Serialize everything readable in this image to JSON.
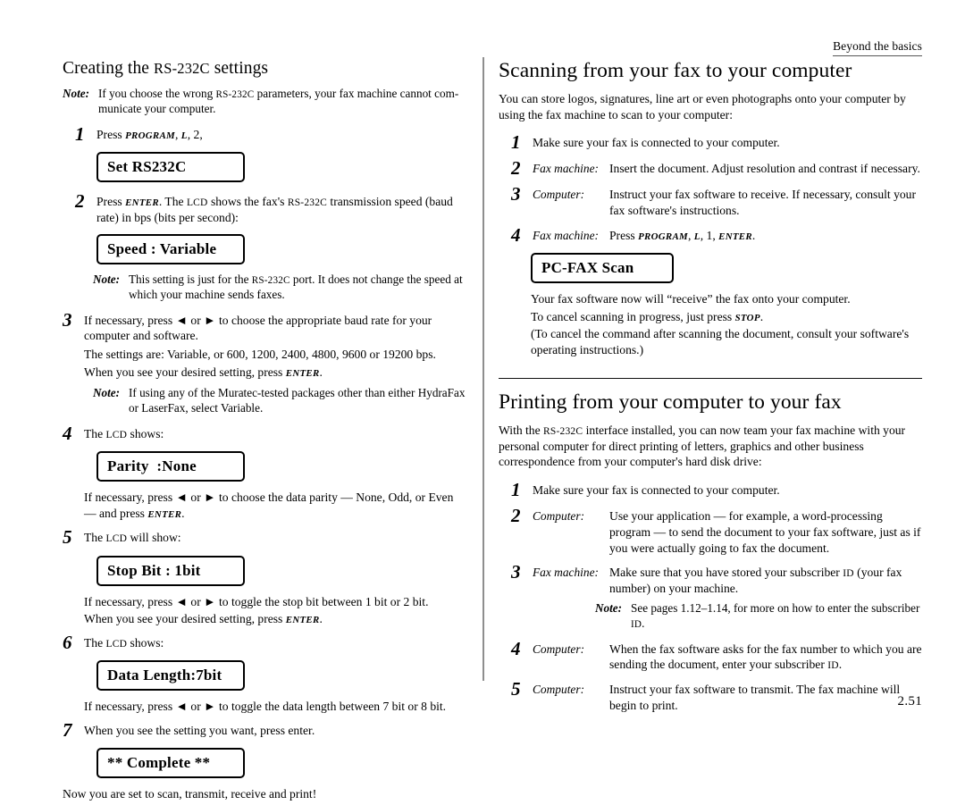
{
  "running_head": "Beyond the basics",
  "folio": "2.51",
  "left_column": {
    "heading_pre": "Creating the ",
    "heading_sc": "RS-232C",
    "heading_post": " settings",
    "note_top": {
      "label": "Note:",
      "text_a": "If you choose the wrong ",
      "text_sc": "RS-232C",
      "text_b": " parameters, your fax machine cannot com-municate your computer."
    },
    "step1": {
      "num": "1",
      "text_a": "Press ",
      "kbd1": "PROGRAM",
      "text_b": ", ",
      "kbd2": "L",
      "text_c": ", 2,"
    },
    "lcd1": "Set RS232C",
    "step2": {
      "num": "2",
      "text_a": "Press ",
      "kbd1": "ENTER",
      "text_b": ". The ",
      "sc1": "LCD",
      "text_c": " shows the fax's ",
      "sc2": "RS-232C",
      "text_d": " transmission speed (baud rate) in bps (bits per second):"
    },
    "lcd2": "Speed : Variable",
    "note2": {
      "label": "Note:",
      "text_a": "This setting is just for the ",
      "text_sc": "RS-232C",
      "text_b": " port. It does not change the speed at which your machine sends faxes."
    },
    "step3": {
      "num": "3",
      "text_a": "If necessary, press ",
      "arrow_left": "◄",
      "text_or": " or ",
      "arrow_right": "►",
      "text_b": " to choose the appropriate baud rate for your computer and software.",
      "line2": "The settings are: Variable, or 600, 1200, 2400, 4800, 9600 or 19200 bps.",
      "line3_a": "When you see your desired setting, press ",
      "line3_kbd": "ENTER",
      "line3_b": "."
    },
    "note3": {
      "label": "Note:",
      "text": "If using any of the Muratec-tested packages other than either HydraFax or LaserFax, select Variable."
    },
    "step4": {
      "num": "4",
      "text_a": "The ",
      "sc": "LCD",
      "text_b": " shows:"
    },
    "lcd3": "Parity  :None",
    "after4": {
      "text_a": "If necessary, press ",
      "arrow_left": "◄",
      "text_or": " or ",
      "arrow_right": "►",
      "text_b": " to choose the data parity — None, Odd, or Even — and press ",
      "kbd": "ENTER",
      "text_c": "."
    },
    "step5": {
      "num": "5",
      "text_a": "The ",
      "sc": "LCD",
      "text_b": " will show:"
    },
    "lcd4": "Stop Bit : 1bit",
    "after5": {
      "text_a": "If necessary, press ",
      "arrow_left": "◄",
      "text_or": " or ",
      "arrow_right": "►",
      "text_b": " to toggle the stop bit between 1 bit or 2 bit.",
      "line2_a": "When you see your desired setting, press ",
      "line2_kbd": "ENTER",
      "line2_b": "."
    },
    "step6": {
      "num": "6",
      "text_a": "The ",
      "sc": "LCD",
      "text_b": " shows:"
    },
    "lcd5": "Data Length:7bit",
    "after6": {
      "text_a": "If necessary, press ",
      "arrow_left": "◄",
      "text_or": " or ",
      "arrow_right": "►",
      "text_b": " to toggle the data length between 7 bit or 8 bit."
    },
    "step7": {
      "num": "7",
      "text": "When you see the setting you want, press enter."
    },
    "lcd6": "** Complete **",
    "closing": "Now you are set to scan, transmit, receive and print!"
  },
  "right_column": {
    "heading1": "Scanning from your fax to your computer",
    "intro1": "You can store logos, signatures, line art or even photographs onto your computer by using the fax machine to scan to your computer:",
    "s1_step1": {
      "num": "1",
      "text": "Make sure your fax is connected to your computer."
    },
    "s1_step2": {
      "num": "2",
      "actor": "Fax machine:",
      "text": "Insert the document. Adjust resolution and contrast if necessary."
    },
    "s1_step3": {
      "num": "3",
      "actor": "Computer:",
      "text": "Instruct your fax software to receive. If necessary, consult your fax software's instructions."
    },
    "s1_step4": {
      "num": "4",
      "actor": "Fax machine:",
      "text_a": "Press ",
      "kbd1": "PROGRAM",
      "text_b": ", ",
      "kbd2": "L",
      "text_c": ", 1, ",
      "kbd3": "ENTER",
      "text_d": "."
    },
    "lcd_pcfax": "PC-FAX Scan",
    "s1_after": {
      "line1": "Your fax software now will “receive” the fax onto your computer.",
      "line2_a": "To cancel scanning in progress, just press ",
      "line2_kbd": "STOP",
      "line2_b": ".",
      "line3": "(To cancel the command after scanning the document, consult your software's operating instructions.)"
    },
    "heading2": "Printing from your computer to your fax",
    "intro2_a": "With the ",
    "intro2_sc": "RS-232C",
    "intro2_b": " interface installed, you can now team your fax machine with your personal computer for direct printing of letters, graphics and other business correspondence from your computer's hard disk drive:",
    "s2_step1": {
      "num": "1",
      "text": "Make sure your fax is connected to your computer."
    },
    "s2_step2": {
      "num": "2",
      "actor": "Computer:",
      "text": "Use your application — for example, a word-processing program — to send the document to your fax software, just as if you were actually going to fax the document."
    },
    "s2_step3": {
      "num": "3",
      "actor": "Fax machine:",
      "text_a": "Make sure that you have stored your subscriber ",
      "sc": "ID",
      "text_b": " (your fax number) on your machine."
    },
    "s2_note": {
      "label": "Note:",
      "text_a": "See pages 1.12–1.14, for more on how to enter the subscriber ",
      "sc": "ID",
      "text_b": "."
    },
    "s2_step4": {
      "num": "4",
      "actor": "Computer:",
      "text_a": "When the fax software asks for the fax number to which you are sending the document, enter your subscriber ",
      "sc": "ID",
      "text_b": "."
    },
    "s2_step5": {
      "num": "5",
      "actor": "Computer:",
      "text": "Instruct your fax software to transmit. The fax machine will begin to print."
    }
  }
}
